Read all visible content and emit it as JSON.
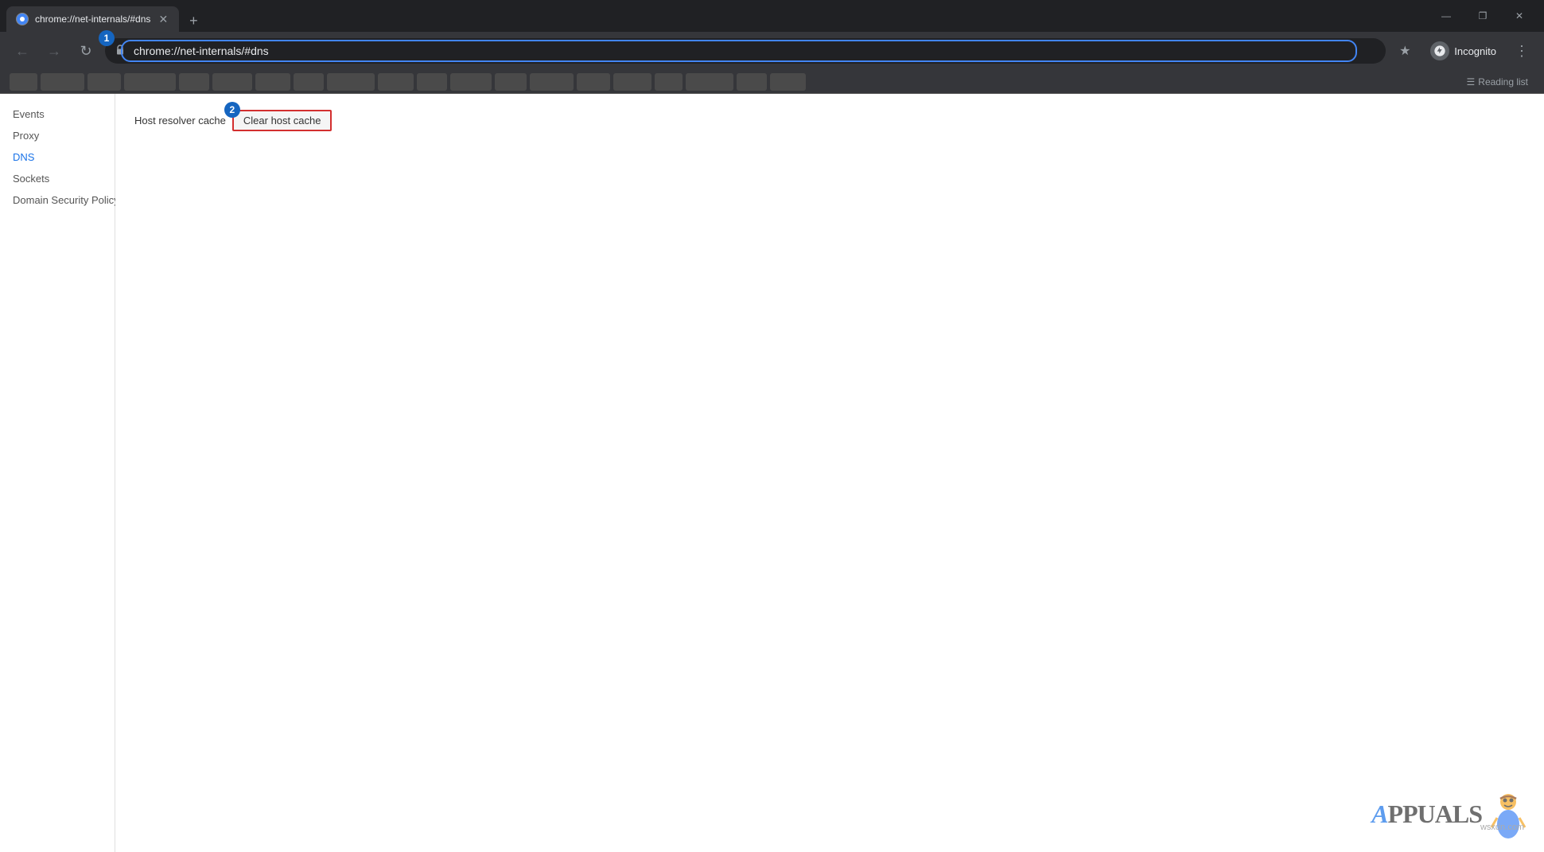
{
  "titlebar": {
    "tab_title": "chrome://net-internals/#dns",
    "tab_favicon": "chrome-icon",
    "new_tab_label": "+",
    "window_controls": {
      "minimize": "—",
      "maximize": "❐",
      "close": "✕"
    }
  },
  "navbar": {
    "back_icon": "←",
    "forward_icon": "→",
    "refresh_icon": "↻",
    "url": "chrome://net-internals/#dns",
    "url_display": "chrome://net-internals/#dns",
    "bookmark_icon": "☆",
    "incognito_label": "Incognito",
    "menu_icon": "⋮"
  },
  "bookmarks_bar": {
    "reading_list_label": "Reading list",
    "reading_list_icon": "☰"
  },
  "sidebar": {
    "items": [
      {
        "label": "Events",
        "id": "events",
        "active": false
      },
      {
        "label": "Proxy",
        "id": "proxy",
        "active": false
      },
      {
        "label": "DNS",
        "id": "dns",
        "active": true
      },
      {
        "label": "Sockets",
        "id": "sockets",
        "active": false
      },
      {
        "label": "Domain Security Policy",
        "id": "domain-security-policy",
        "active": false
      }
    ]
  },
  "dns_page": {
    "host_resolver_label": "Host resolver cache",
    "clear_cache_button_label": "Clear host cache"
  },
  "annotations": {
    "badge1_number": "1",
    "badge2_number": "2"
  },
  "watermark": {
    "text_a": "A",
    "text_ppuals": "PPUALS",
    "domain": "wsxdn.com"
  }
}
